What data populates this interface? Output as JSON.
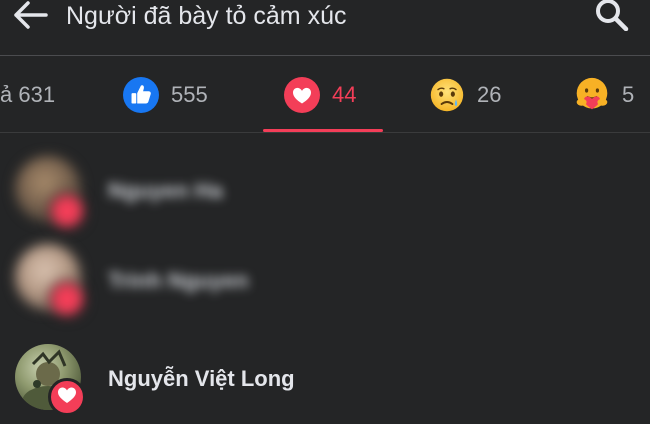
{
  "header": {
    "back_icon": "arrow-left-icon",
    "title": "Người đã bày tỏ cảm xúc",
    "search_icon": "search-icon"
  },
  "tabs": [
    {
      "label": "ả 631",
      "icon": "none"
    },
    {
      "label": "555",
      "icon": "like-icon",
      "color": "#1877f2"
    },
    {
      "label": "44",
      "icon": "love-icon",
      "color": "#f33e58",
      "active": true
    },
    {
      "label": "26",
      "icon": "sad-icon"
    },
    {
      "label": "5",
      "icon": "care-icon"
    }
  ],
  "people": [
    {
      "name": "Nguyen Ha",
      "blurred": true,
      "reaction": "love-icon"
    },
    {
      "name": "Trinh Nguyen",
      "blurred": true,
      "reaction": "love-icon"
    },
    {
      "name": "Nguyễn Việt Long",
      "blurred": false,
      "reaction": "love-icon"
    }
  ],
  "colors": {
    "background": "#242526",
    "accent": "#f33e58",
    "text": "#e4e6eb",
    "muted": "#b0b3b8"
  }
}
